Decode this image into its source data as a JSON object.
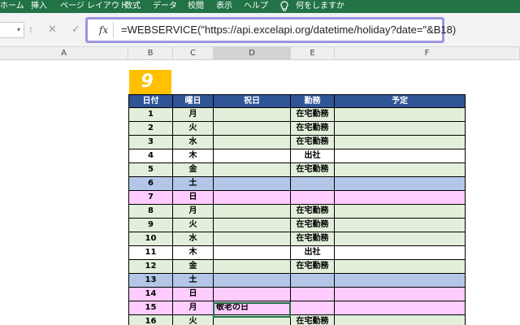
{
  "ribbon": {
    "tabs": [
      "ホーム",
      "挿入",
      "ページ レイアウト",
      "数式",
      "データ",
      "校閲",
      "表示",
      "ヘルプ"
    ],
    "tell_me": "何をしますか",
    "bulb_icon": "lightbulb-icon",
    "color": "#217346"
  },
  "formula_bar": {
    "fx_label": "fx",
    "formula": "=WEBSERVICE(\"https://api.excelapi.org/datetime/holiday?date=\"&B18)",
    "highlight_color": "#9b96e0"
  },
  "columns": [
    "A",
    "B",
    "C",
    "D",
    "E",
    "F"
  ],
  "sheet": {
    "month": "9",
    "headers": [
      "日付",
      "曜日",
      "祝日",
      "勤務",
      "予定"
    ],
    "rows": [
      {
        "day": "1",
        "dow": "月",
        "holiday": "",
        "work": "在宅勤務",
        "plan": "",
        "type": "weekday"
      },
      {
        "day": "2",
        "dow": "火",
        "holiday": "",
        "work": "在宅勤務",
        "plan": "",
        "type": "weekday"
      },
      {
        "day": "3",
        "dow": "水",
        "holiday": "",
        "work": "在宅勤務",
        "plan": "",
        "type": "weekday"
      },
      {
        "day": "4",
        "dow": "木",
        "holiday": "",
        "work": "出社",
        "plan": "",
        "type": "office"
      },
      {
        "day": "5",
        "dow": "金",
        "holiday": "",
        "work": "在宅勤務",
        "plan": "",
        "type": "weekday"
      },
      {
        "day": "6",
        "dow": "土",
        "holiday": "",
        "work": "",
        "plan": "",
        "type": "sat"
      },
      {
        "day": "7",
        "dow": "日",
        "holiday": "",
        "work": "",
        "plan": "",
        "type": "sun"
      },
      {
        "day": "8",
        "dow": "月",
        "holiday": "",
        "work": "在宅勤務",
        "plan": "",
        "type": "weekday"
      },
      {
        "day": "9",
        "dow": "火",
        "holiday": "",
        "work": "在宅勤務",
        "plan": "",
        "type": "weekday"
      },
      {
        "day": "10",
        "dow": "水",
        "holiday": "",
        "work": "在宅勤務",
        "plan": "",
        "type": "weekday"
      },
      {
        "day": "11",
        "dow": "木",
        "holiday": "",
        "work": "出社",
        "plan": "",
        "type": "office"
      },
      {
        "day": "12",
        "dow": "金",
        "holiday": "",
        "work": "在宅勤務",
        "plan": "",
        "type": "weekday"
      },
      {
        "day": "13",
        "dow": "土",
        "holiday": "",
        "work": "",
        "plan": "",
        "type": "sat"
      },
      {
        "day": "14",
        "dow": "日",
        "holiday": "",
        "work": "",
        "plan": "",
        "type": "sun"
      },
      {
        "day": "15",
        "dow": "月",
        "holiday": "敬老の日",
        "work": "",
        "plan": "",
        "type": "sun"
      },
      {
        "day": "16",
        "dow": "火",
        "holiday": "",
        "work": "在宅勤務",
        "plan": "",
        "type": "weekday"
      }
    ]
  }
}
